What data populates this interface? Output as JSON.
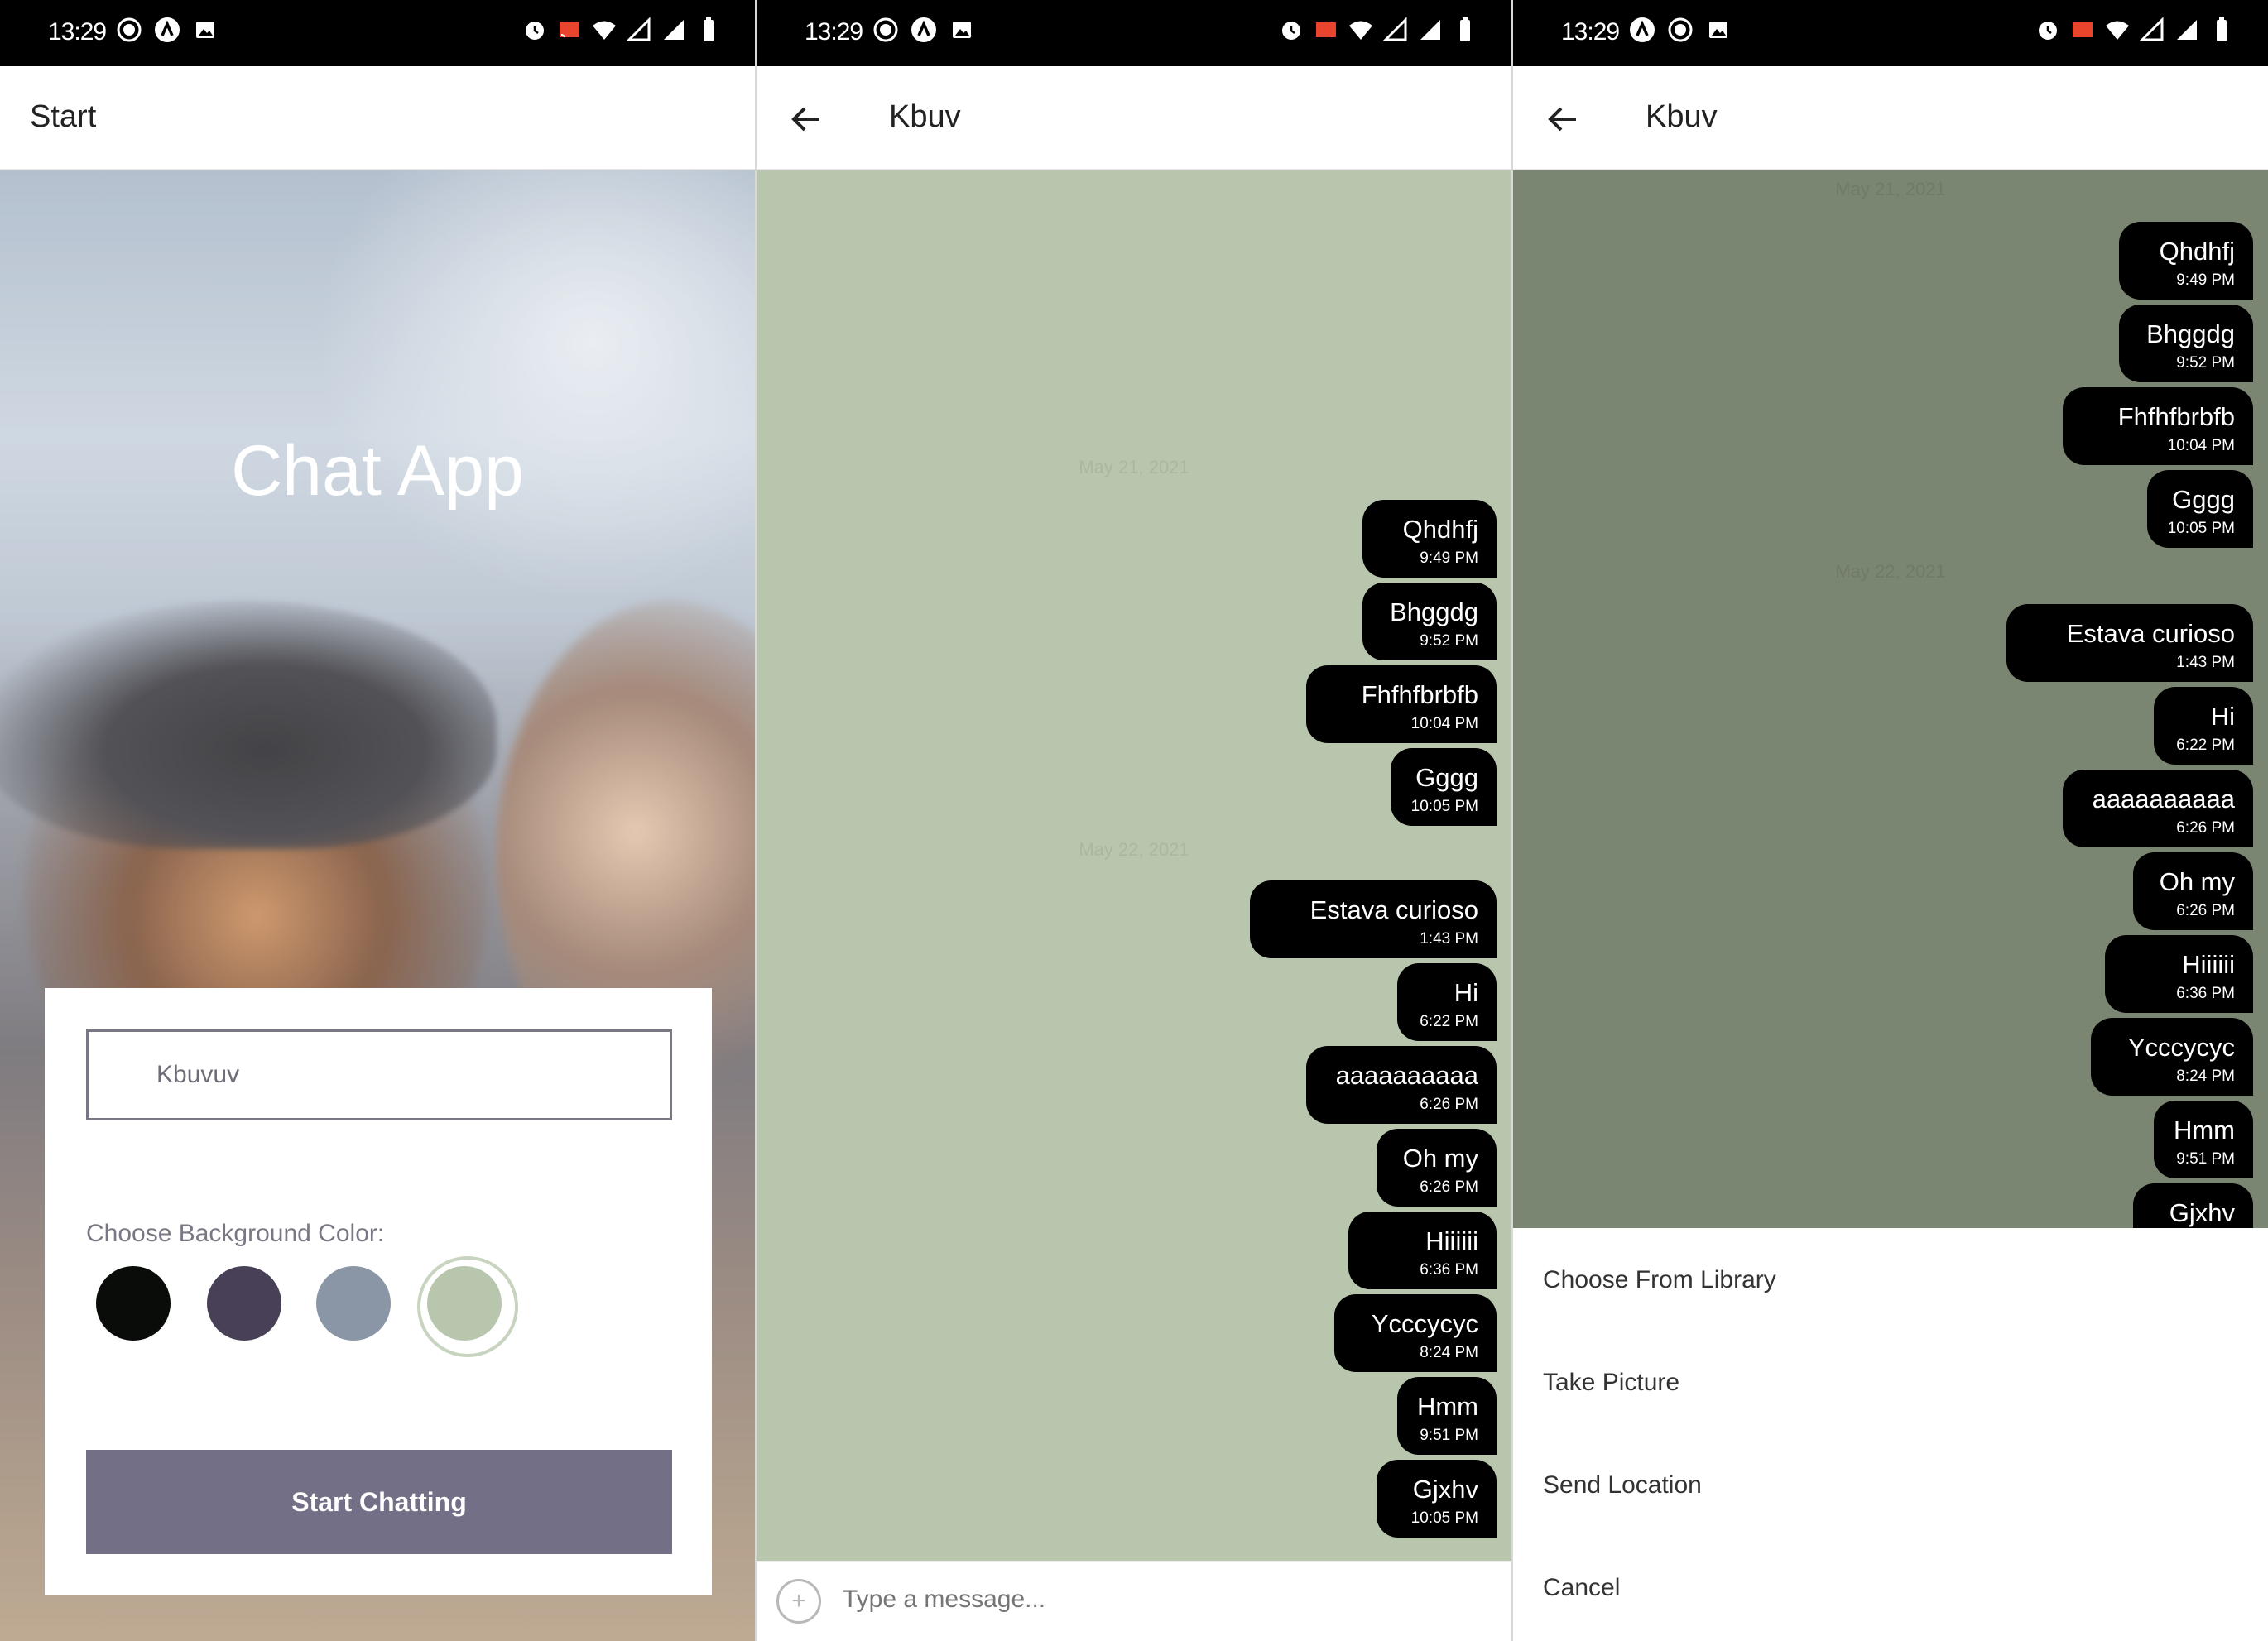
{
  "status_bar": {
    "time": "13:29"
  },
  "panel1": {
    "header_title": "Start",
    "app_title": "Chat App",
    "name_input_value": "Kbuvuv",
    "choose_label": "Choose Background Color:",
    "swatches": [
      "#090c08",
      "#474056",
      "#8a95a5",
      "#b9c6ae"
    ],
    "selected_swatch": "#b9c6ae",
    "start_button": "Start Chatting",
    "button_color": "#736f87"
  },
  "panel2": {
    "header_title": "Kbuv",
    "background_color": "#b9c6ae",
    "day_labels": [
      "May 21, 2021",
      "May 22, 2021"
    ],
    "messages": [
      {
        "text": "Qhdhfj",
        "time": "9:49 PM"
      },
      {
        "text": "Bhggdg",
        "time": "9:52 PM"
      },
      {
        "text": "Fhfhfbrbfb",
        "time": "10:04 PM"
      },
      {
        "text": "Gggg",
        "time": "10:05 PM"
      },
      {
        "text": "Estava curioso",
        "time": "1:43 PM"
      },
      {
        "text": "Hi",
        "time": "6:22 PM"
      },
      {
        "text": "aaaaaaaaaa",
        "time": "6:26 PM"
      },
      {
        "text": "Oh my",
        "time": "6:26 PM"
      },
      {
        "text": "Hiiiiii",
        "time": "6:36 PM"
      },
      {
        "text": "Ycccycyc",
        "time": "8:24 PM"
      },
      {
        "text": "Hmm",
        "time": "9:51 PM"
      },
      {
        "text": "Gjxhv",
        "time": "10:05 PM"
      }
    ],
    "composer_placeholder": "Type a message...",
    "composer_plus": "+"
  },
  "panel3": {
    "header_title": "Kbuv",
    "background_color": "#7b8672",
    "day_labels": [
      "May 21, 2021",
      "May 22, 2021"
    ],
    "messages": [
      {
        "text": "Qhdhfj",
        "time": "9:49 PM"
      },
      {
        "text": "Bhggdg",
        "time": "9:52 PM"
      },
      {
        "text": "Fhfhfbrbfb",
        "time": "10:04 PM"
      },
      {
        "text": "Gggg",
        "time": "10:05 PM"
      },
      {
        "text": "Estava curioso",
        "time": "1:43 PM"
      },
      {
        "text": "Hi",
        "time": "6:22 PM"
      },
      {
        "text": "aaaaaaaaaa",
        "time": "6:26 PM"
      },
      {
        "text": "Oh my",
        "time": "6:26 PM"
      },
      {
        "text": "Hiiiiii",
        "time": "6:36 PM"
      },
      {
        "text": "Ycccycyc",
        "time": "8:24 PM"
      },
      {
        "text": "Hmm",
        "time": "9:51 PM"
      },
      {
        "text": "Gjxhv",
        "time": ""
      }
    ],
    "action_sheet": [
      "Choose From Library",
      "Take Picture",
      "Send Location",
      "Cancel"
    ]
  }
}
